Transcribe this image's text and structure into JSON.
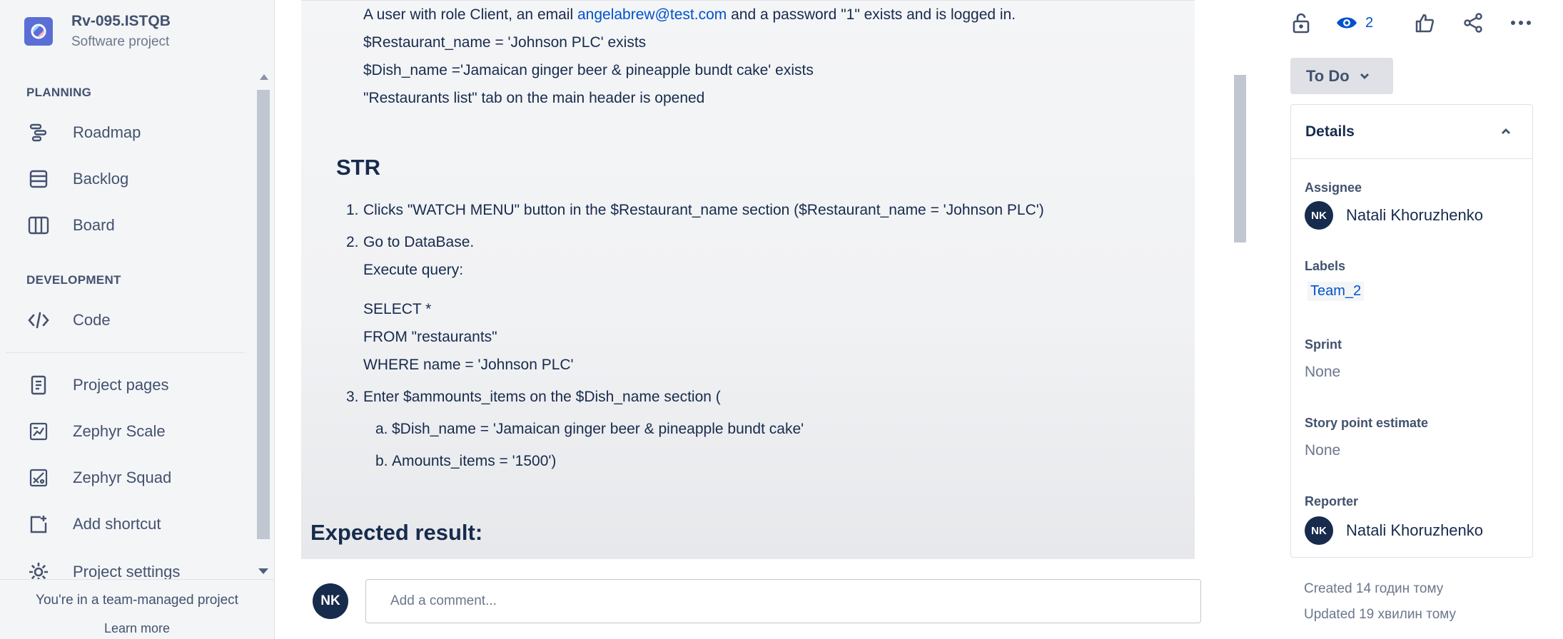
{
  "project": {
    "name": "Rv-095.ISTQB",
    "type": "Software project"
  },
  "sidebar": {
    "planning_label": "PLANNING",
    "development_label": "DEVELOPMENT",
    "items": [
      {
        "label": "Roadmap",
        "icon": "roadmap-icon"
      },
      {
        "label": "Backlog",
        "icon": "backlog-icon"
      },
      {
        "label": "Board",
        "icon": "board-icon"
      },
      {
        "label": "Code",
        "icon": "code-icon"
      },
      {
        "label": "Project pages",
        "icon": "pages-icon"
      },
      {
        "label": "Zephyr Scale",
        "icon": "zephyr-scale-icon"
      },
      {
        "label": "Zephyr Squad",
        "icon": "zephyr-squad-icon"
      },
      {
        "label": "Add shortcut",
        "icon": "add-shortcut-icon"
      },
      {
        "label": "Project settings",
        "icon": "gear-icon"
      }
    ],
    "footer_text": "You're in a team-managed project",
    "learn_more": "Learn more"
  },
  "content": {
    "precondition_user": "A user with role Client, an email",
    "precondition_email": "angelabrew@test.com",
    "precondition_tail": "and a password \"1\" exists and is logged in.",
    "precondition_restaurant": "$Restaurant_name = 'Johnson PLC' exists",
    "precondition_dish": "$Dish_name ='Jamaican ginger beer & pineapple bundt cake' exists",
    "precondition_tab": "\"Restaurants list\" tab on the main header is opened",
    "str_heading": "STR",
    "steps": {
      "s1_num": "1.",
      "s1": "Clicks \"WATCH MENU\" button in the $Restaurant_name section ($Restaurant_name = 'Johnson PLC')",
      "s2_num": "2.",
      "s2": "Go to DataBase.",
      "s2_exec": "Execute query:",
      "sql1": "SELECT *",
      "sql2": "FROM \"restaurants\"",
      "sql3": "WHERE name = 'Johnson PLC'",
      "s3_num": "3.",
      "s3": "Enter $ammounts_items on the $Dish_name section (",
      "s3a_num": "a.",
      "s3a": "$Dish_name = 'Jamaican ginger beer & pineapple bundt cake'",
      "s3b_num": "b.",
      "s3b": "Amounts_items = '1500')"
    },
    "expected_heading": "Expected result:"
  },
  "comment": {
    "avatar": "NK",
    "placeholder": "Add a comment..."
  },
  "right": {
    "watchers_count": "2",
    "status": "To Do",
    "details_title": "Details",
    "assignee_label": "Assignee",
    "assignee_initials": "NK",
    "assignee_name": "Natali Khoruzhenko",
    "labels_label": "Labels",
    "label_value": "Team_2",
    "sprint_label": "Sprint",
    "sprint_value": "None",
    "story_points_label": "Story point estimate",
    "story_points_value": "None",
    "reporter_label": "Reporter",
    "reporter_initials": "NK",
    "reporter_name": "Natali Khoruzhenko",
    "created": "Created 14 годин тому",
    "updated": "Updated 19 хвилин тому"
  },
  "colors": {
    "accent": "#0052cc",
    "avatar_bg": "#172b4d",
    "project_avatar": "#5a6ed6"
  }
}
